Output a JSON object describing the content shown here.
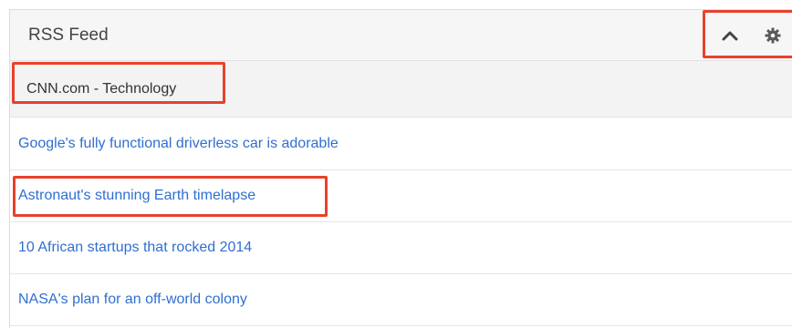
{
  "dashlet": {
    "title": "RSS Feed",
    "controls": {
      "collapse_icon": "chevron-up-icon",
      "settings_icon": "gear-icon"
    }
  },
  "feed": {
    "source_title": "CNN.com - Technology",
    "items": [
      {
        "label": "Google's fully functional driverless car is adorable"
      },
      {
        "label": "Astronaut's stunning Earth timelapse"
      },
      {
        "label": "10 African startups that rocked 2014"
      },
      {
        "label": "NASA's plan for an off-world colony"
      }
    ]
  },
  "colors": {
    "highlight": "#e8412c",
    "link": "#2f6fd2",
    "header_bg": "#f6f6f6"
  }
}
